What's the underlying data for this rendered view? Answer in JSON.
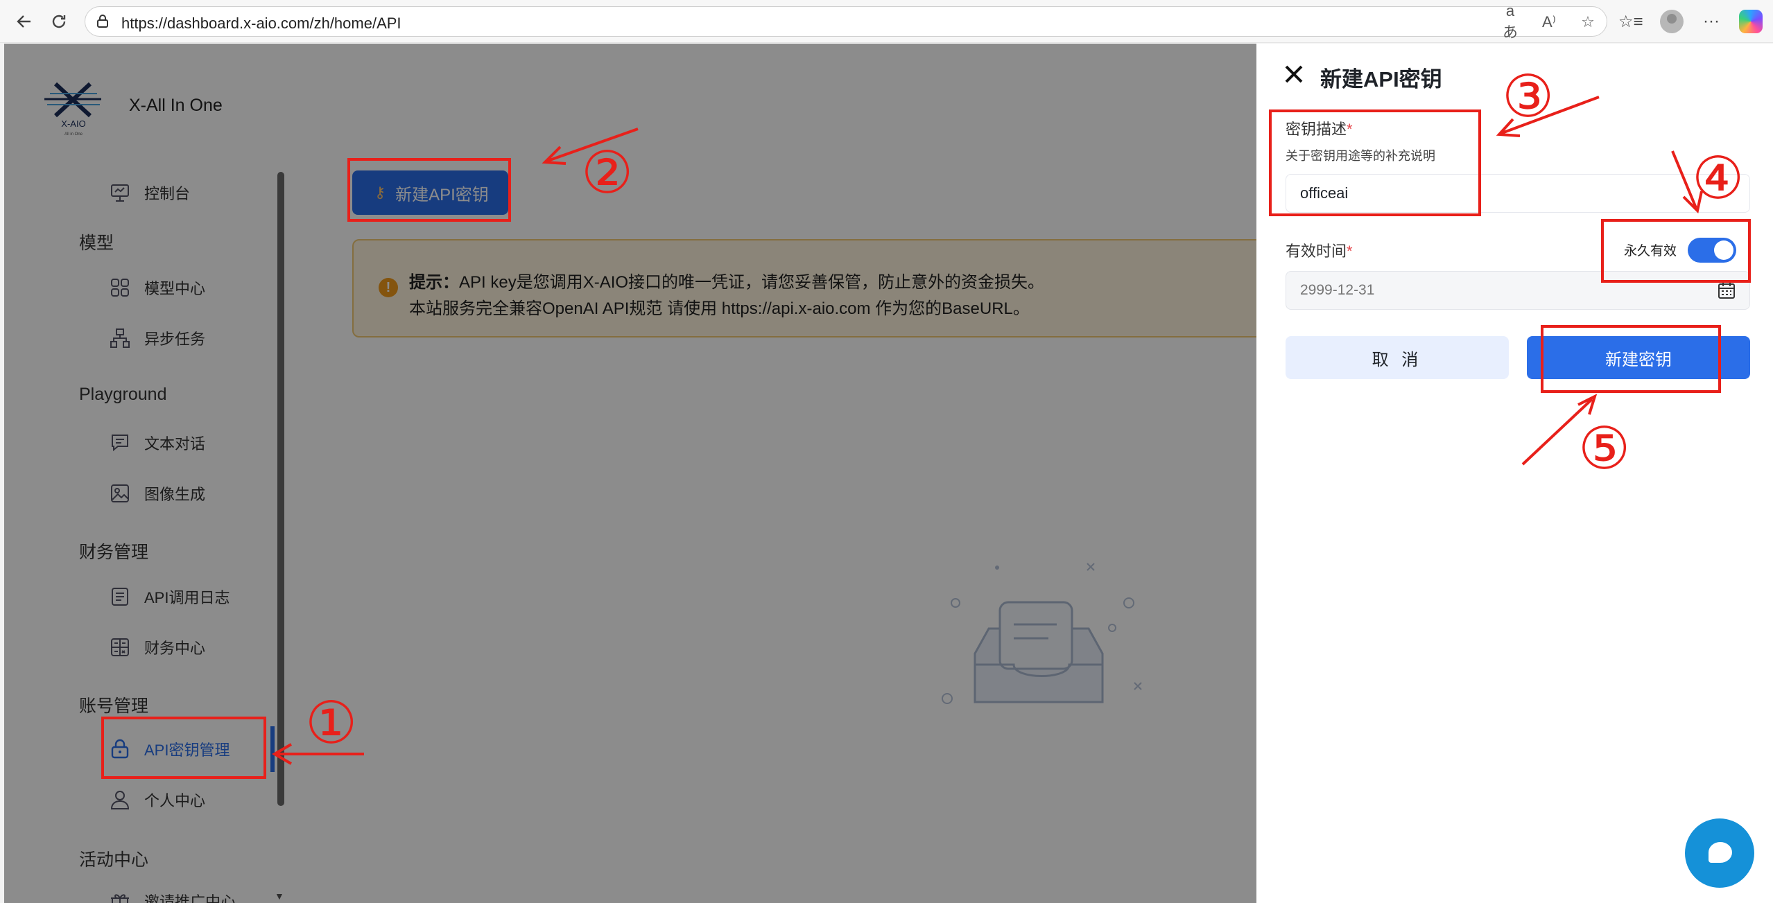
{
  "browser": {
    "url": "https://dashboard.x-aio.com/zh/home/API"
  },
  "app": {
    "brand": "X-All In One",
    "logo_text": "X-AIO",
    "logo_subtext": "All in One"
  },
  "sidebar": {
    "items": [
      {
        "label": "控制台",
        "icon": "presentation-icon"
      },
      {
        "label": "模型中心",
        "icon": "grid-icon"
      },
      {
        "label": "异步任务",
        "icon": "hierarchy-icon"
      },
      {
        "label": "文本对话",
        "icon": "chat-icon"
      },
      {
        "label": "图像生成",
        "icon": "image-icon"
      },
      {
        "label": "API调用日志",
        "icon": "log-icon"
      },
      {
        "label": "财务中心",
        "icon": "finance-icon"
      },
      {
        "label": "API密钥管理",
        "icon": "lock-icon",
        "active": true
      },
      {
        "label": "个人中心",
        "icon": "user-icon"
      },
      {
        "label": "邀请推广中心",
        "icon": "gift-icon"
      }
    ],
    "groups": {
      "models": "模型",
      "playground": "Playground",
      "finance": "财务管理",
      "account": "账号管理",
      "activity": "活动中心"
    }
  },
  "main": {
    "new_key_button": "新建API密钥",
    "notice_prefix": "提示：",
    "notice_line1": "API key是您调用X-AIO接口的唯一凭证，请您妥善保管，防止意外的资金损失。",
    "notice_line2": "本站服务完全兼容OpenAI API规范 请使用 https://api.x-aio.com 作为您的BaseURL。"
  },
  "drawer": {
    "title": "新建API密钥",
    "desc_label": "密钥描述",
    "desc_hint": "关于密钥用途等的补充说明",
    "desc_value": "officeai",
    "validity_label": "有效时间",
    "permanent_label": "永久有效",
    "permanent_enabled": true,
    "date_placeholder": "2999-12-31",
    "cancel_label": "取 消",
    "create_label": "新建密钥",
    "required_mark": "*"
  },
  "annotations": {
    "color": "#e8201a",
    "step_marks": [
      "①",
      "②",
      "③",
      "④",
      "⑤"
    ]
  },
  "colors": {
    "accent": "#2b6ee8",
    "notice_bg": "#fdf3dc",
    "overlay": "rgba(0,0,0,0.45)"
  }
}
